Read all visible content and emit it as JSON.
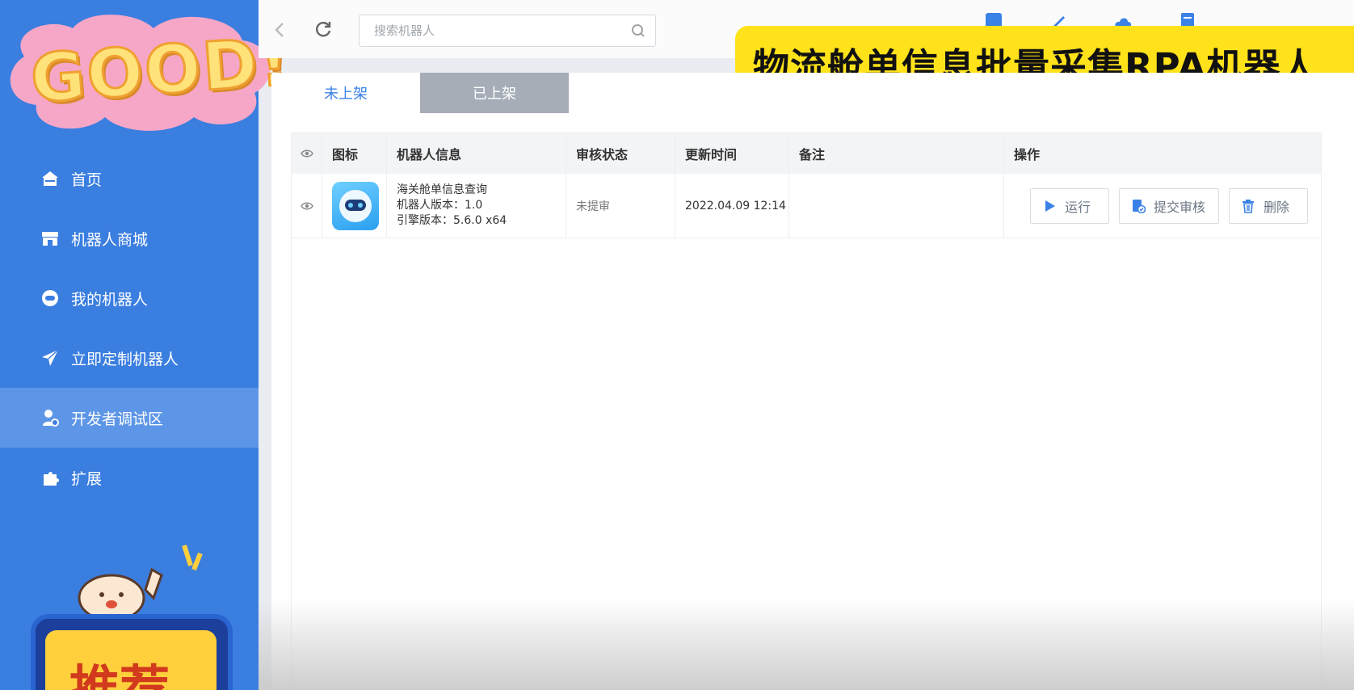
{
  "banner": {
    "title": "物流舱单信息批量采集RPA机器人"
  },
  "sticker": {
    "good": "GOOD!",
    "recommend": "推荐"
  },
  "search": {
    "placeholder": "搜索机器人"
  },
  "sidebar": {
    "items": [
      {
        "label": "首页",
        "icon": "home-icon",
        "active": false
      },
      {
        "label": "机器人商城",
        "icon": "store-icon",
        "active": false
      },
      {
        "label": "我的机器人",
        "icon": "robot-icon",
        "active": false
      },
      {
        "label": "立即定制机器人",
        "icon": "paper-plane-icon",
        "active": false
      },
      {
        "label": "开发者调试区",
        "icon": "developer-icon",
        "active": true
      },
      {
        "label": "扩展",
        "icon": "puzzle-icon",
        "active": false
      }
    ]
  },
  "tabs": [
    {
      "label": "未上架",
      "active": true
    },
    {
      "label": "已上架",
      "active": false
    }
  ],
  "table": {
    "headers": {
      "icon": "图标",
      "info": "机器人信息",
      "status": "审核状态",
      "time": "更新时间",
      "note": "备注",
      "ops": "操作"
    },
    "rows": [
      {
        "name": "海关舱单信息查询",
        "version": "机器人版本：1.0",
        "engine": "引擎版本：5.6.0 x64",
        "status": "未提审",
        "updated": "2022.04.09 12:14",
        "note": ""
      }
    ],
    "actions": {
      "run": "运行",
      "submit": "提交审核",
      "delete": "删除"
    }
  },
  "colors": {
    "sidebar": "#3a7ee0",
    "accent": "#3b82e6",
    "banner": "#ffe21a"
  }
}
